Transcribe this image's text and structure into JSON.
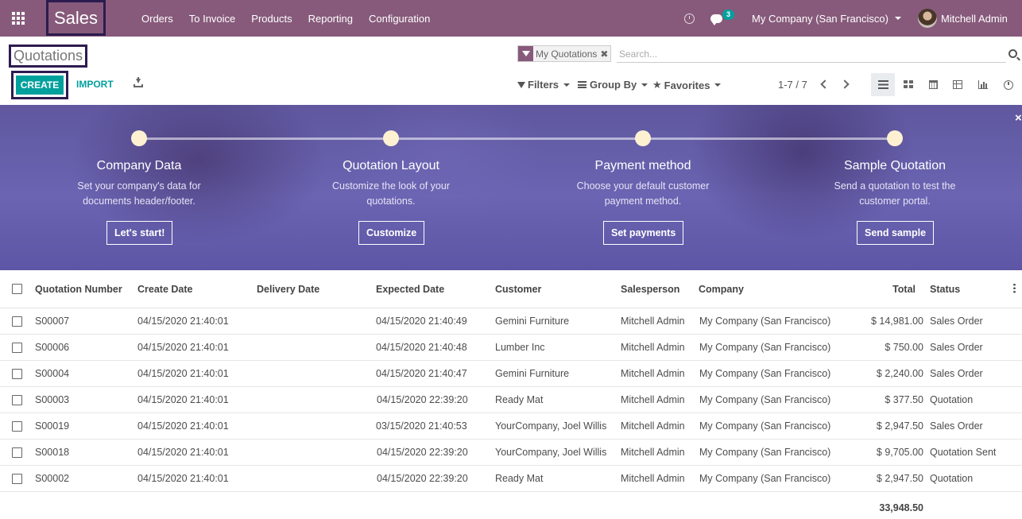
{
  "navbar": {
    "app_title": "Sales",
    "menu": [
      "Orders",
      "To Invoice",
      "Products",
      "Reporting",
      "Configuration"
    ],
    "messages_badge": "3",
    "company": "My Company (San Francisco)",
    "user": "Mitchell Admin",
    "accent_color": "#875a7b"
  },
  "control_panel": {
    "page_title": "Quotations",
    "facet_label": "My Quotations",
    "search_placeholder": "Search...",
    "create_label": "CREATE",
    "import_label": "IMPORT",
    "filters_label": "Filters",
    "group_by_label": "Group By",
    "favorites_label": "Favorites",
    "pager": "1-7 / 7",
    "views": [
      "list-view-icon",
      "kanban-view-icon",
      "calendar-view-icon",
      "pivot-view-icon",
      "graph-view-icon",
      "activity-view-icon"
    ],
    "primary_color": "#00a09d"
  },
  "onboarding": {
    "steps": [
      {
        "title": "Company Data",
        "desc1": "Set your company's data for",
        "desc2": "documents header/footer.",
        "button": "Let's start!"
      },
      {
        "title": "Quotation Layout",
        "desc1": "Customize the look of your",
        "desc2": "quotations.",
        "button": "Customize"
      },
      {
        "title": "Payment method",
        "desc1": "Choose your default customer",
        "desc2": "payment method.",
        "button": "Set payments"
      },
      {
        "title": "Sample Quotation",
        "desc1": "Send a quotation to test the",
        "desc2": "customer portal.",
        "button": "Send sample"
      }
    ],
    "close_symbol": "×"
  },
  "table": {
    "headers": [
      "Quotation Number",
      "Create Date",
      "Delivery Date",
      "Expected Date",
      "Customer",
      "Salesperson",
      "Company",
      "Total",
      "Status"
    ],
    "rows": [
      [
        "S00007",
        "04/15/2020 21:40:01",
        "",
        "04/15/2020 21:40:49",
        "Gemini Furniture",
        "Mitchell Admin",
        "My Company (San Francisco)",
        "$ 14,981.00",
        "Sales Order"
      ],
      [
        "S00006",
        "04/15/2020 21:40:01",
        "",
        "04/15/2020 21:40:48",
        "Lumber Inc",
        "Mitchell Admin",
        "My Company (San Francisco)",
        "$ 750.00",
        "Sales Order"
      ],
      [
        "S00004",
        "04/15/2020 21:40:01",
        "",
        "04/15/2020 21:40:47",
        "Gemini Furniture",
        "Mitchell Admin",
        "My Company (San Francisco)",
        "$ 2,240.00",
        "Sales Order"
      ],
      [
        "S00003",
        "04/15/2020 21:40:01",
        "",
        "04/15/2020 22:39:20",
        "Ready Mat",
        "Mitchell Admin",
        "My Company (San Francisco)",
        "$ 377.50",
        "Quotation"
      ],
      [
        "S00019",
        "04/15/2020 21:40:01",
        "",
        "03/15/2020 21:40:53",
        "YourCompany, Joel Willis",
        "Mitchell Admin",
        "My Company (San Francisco)",
        "$ 2,947.50",
        "Sales Order"
      ],
      [
        "S00018",
        "04/15/2020 21:40:01",
        "",
        "04/15/2020 22:39:20",
        "YourCompany, Joel Willis",
        "Mitchell Admin",
        "My Company (San Francisco)",
        "$ 9,705.00",
        "Quotation Sent"
      ],
      [
        "S00002",
        "04/15/2020 21:40:01",
        "",
        "04/15/2020 22:39:20",
        "Ready Mat",
        "Mitchell Admin",
        "My Company (San Francisco)",
        "$ 2,947.50",
        "Quotation"
      ]
    ],
    "sum_total": "33,948.50"
  }
}
